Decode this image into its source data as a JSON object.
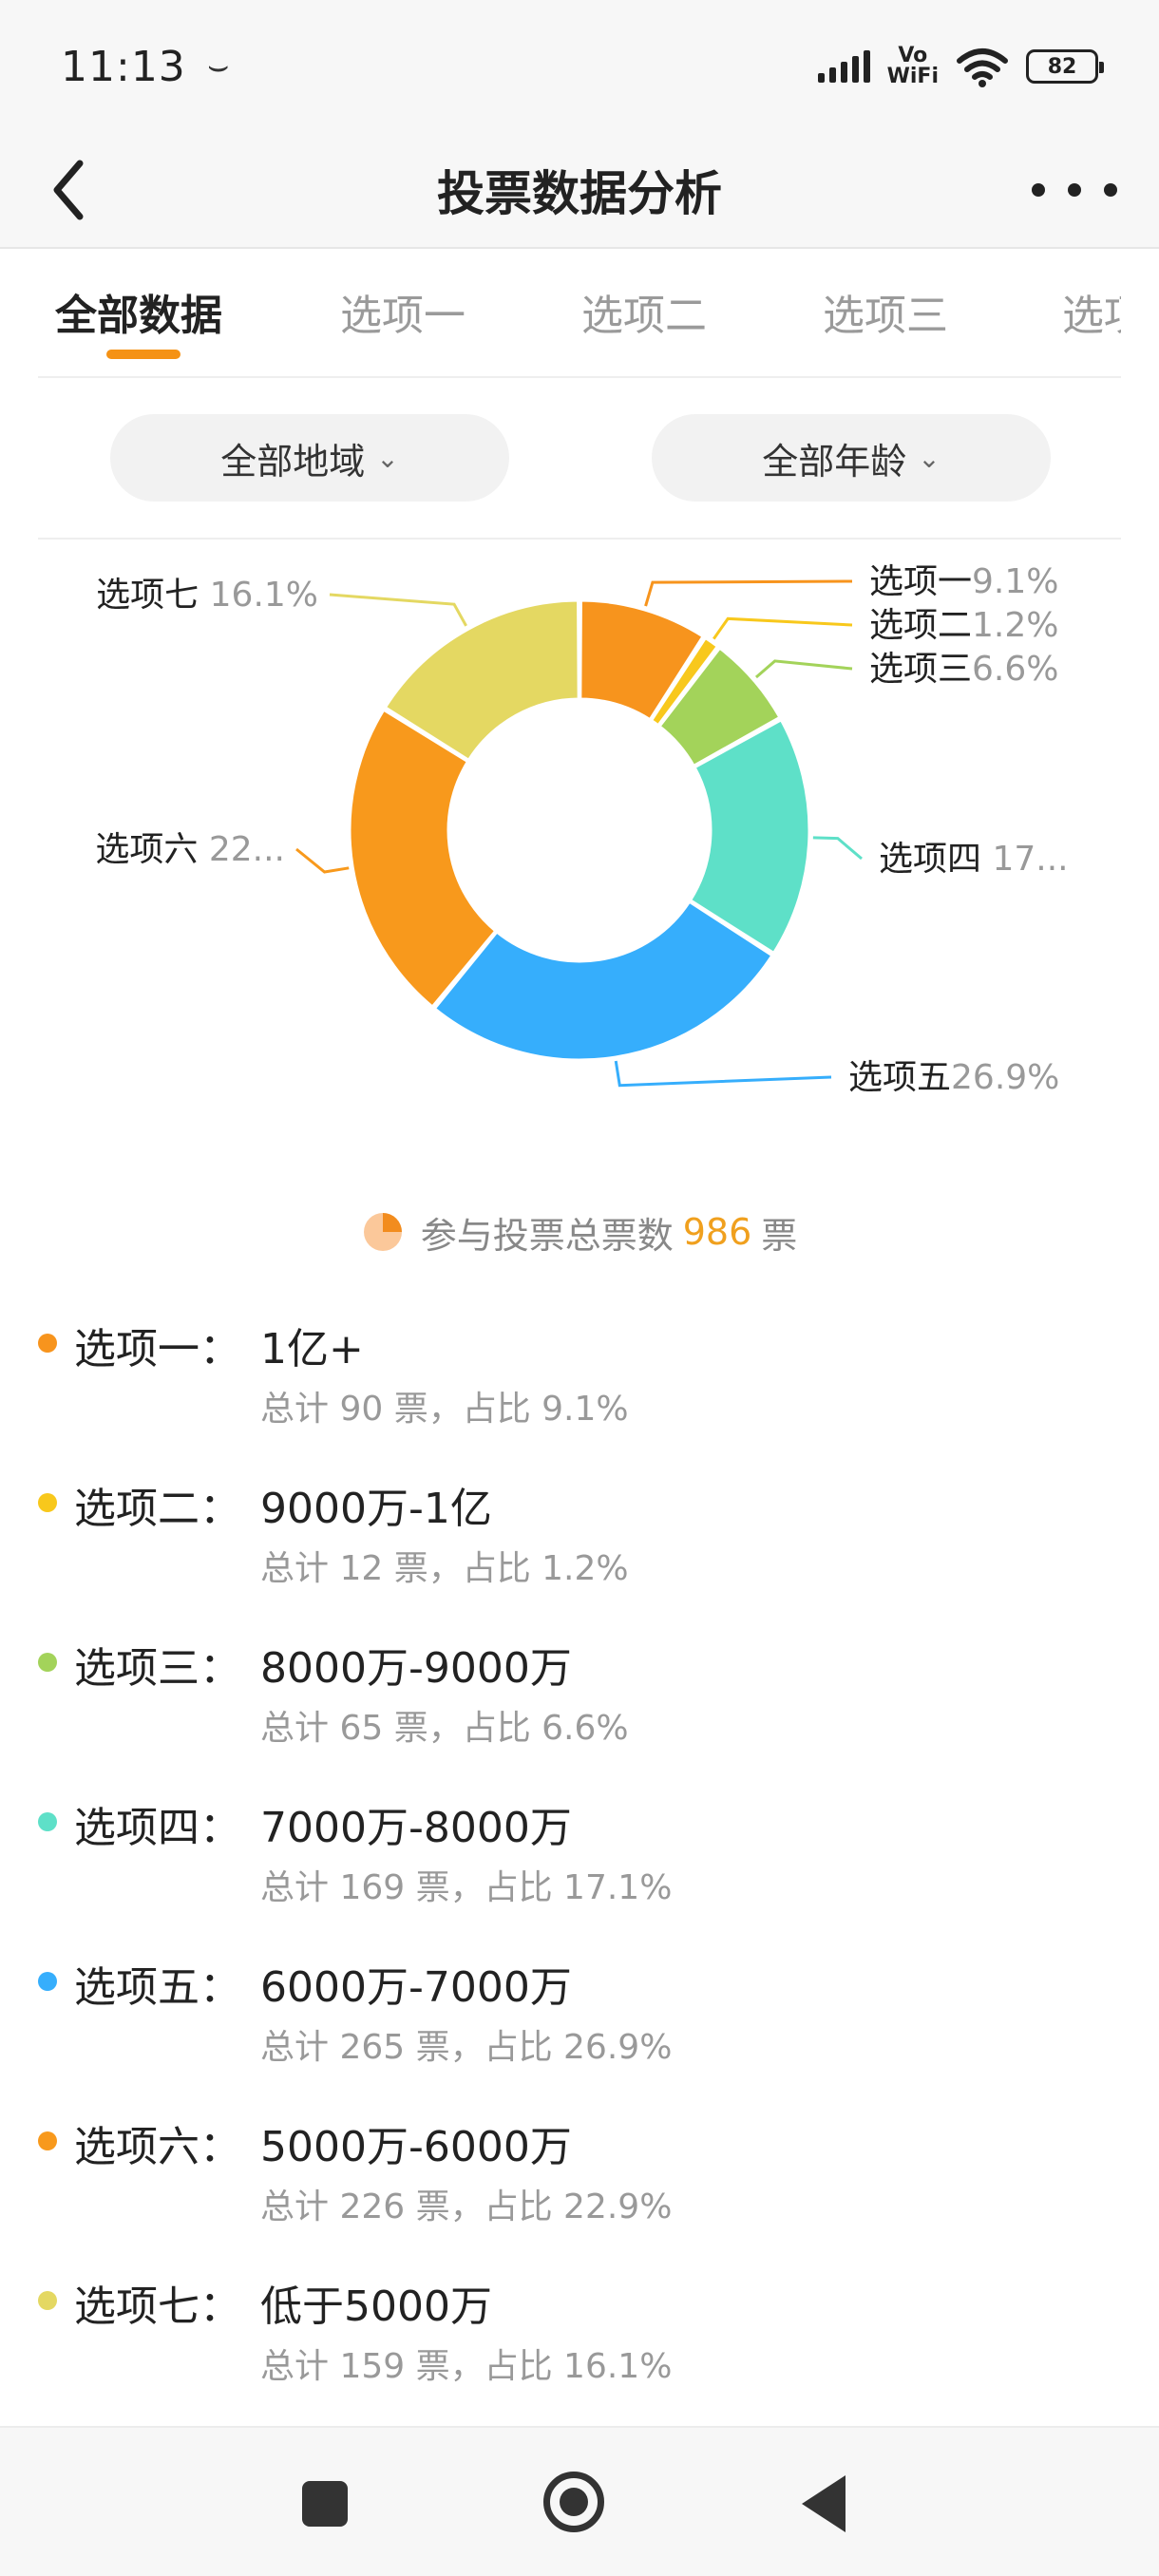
{
  "status": {
    "time": "11:13",
    "extra": "⌣",
    "vowifi_top": "Vo",
    "vowifi_bottom": "WiFi",
    "battery": "82"
  },
  "header": {
    "title": "投票数据分析"
  },
  "tabs": [
    {
      "label": "全部数据",
      "active": true
    },
    {
      "label": "选项一",
      "active": false
    },
    {
      "label": "选项二",
      "active": false
    },
    {
      "label": "选项三",
      "active": false
    },
    {
      "label": "选项四",
      "active": false
    }
  ],
  "filters": {
    "region": "全部地域",
    "age": "全部年龄",
    "chevron": "⌄"
  },
  "chart_data": {
    "type": "pie",
    "donut": true,
    "categories": [
      "选项一",
      "选项二",
      "选项三",
      "选项四",
      "选项五",
      "选项六",
      "选项七"
    ],
    "values": [
      90,
      12,
      65,
      169,
      265,
      226,
      159
    ],
    "percent_labels": [
      "9.1%",
      "1.2%",
      "6.6%",
      "17...",
      "26.9%",
      "22...",
      "16.1%"
    ],
    "colors": [
      "#f7941d",
      "#f8c81c",
      "#a3d35a",
      "#5ee0c8",
      "#36aefc",
      "#f8991c",
      "#e4d862"
    ]
  },
  "total": {
    "prefix": "参与投票总票数",
    "count": "986",
    "suffix": "票"
  },
  "options": [
    {
      "name": "选项一：",
      "value": "1亿+",
      "detail": "总计 90 票，占比 9.1%",
      "color": "#f7941d"
    },
    {
      "name": "选项二：",
      "value": "9000万-1亿",
      "detail": "总计 12 票，占比 1.2%",
      "color": "#f8c81c"
    },
    {
      "name": "选项三：",
      "value": "8000万-9000万",
      "detail": "总计 65 票，占比 6.6%",
      "color": "#a3d35a"
    },
    {
      "name": "选项四：",
      "value": "7000万-8000万",
      "detail": "总计 169 票，占比 17.1%",
      "color": "#5ee0c8"
    },
    {
      "name": "选项五：",
      "value": "6000万-7000万",
      "detail": "总计 265 票，占比 26.9%",
      "color": "#36aefc"
    },
    {
      "name": "选项六：",
      "value": "5000万-6000万",
      "detail": "总计 226 票，占比 22.9%",
      "color": "#f8991c"
    },
    {
      "name": "选项七：",
      "value": "低于5000万",
      "detail": "总计 159 票，占比 16.1%",
      "color": "#e4d862"
    }
  ]
}
